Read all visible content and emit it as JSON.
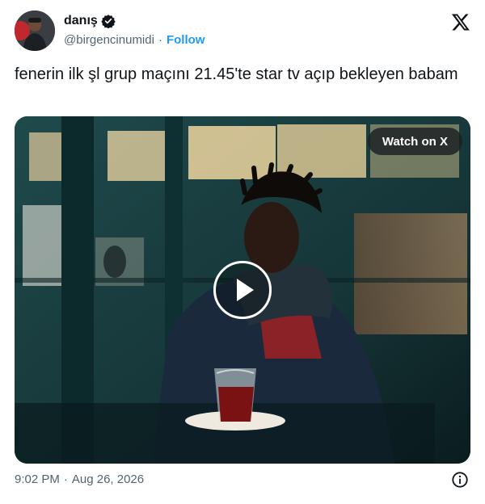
{
  "author": {
    "display_name": "danış",
    "handle": "@birgencinumidi",
    "follow_label": "Follow",
    "separator": "·",
    "verified": true
  },
  "tweet": {
    "text": "fenerin ilk şl grup maçını 21.45'te star tv açıp bekleyen babam"
  },
  "media": {
    "watch_label": "Watch on X",
    "type": "video"
  },
  "footer": {
    "time": "9:02 PM",
    "separator": "·",
    "date": "Aug 26, 2026"
  },
  "icons": {
    "brand": "x-logo-icon",
    "verified": "verified-badge-icon",
    "play": "play-icon",
    "info": "info-icon"
  },
  "colors": {
    "link": "#1d9bf0",
    "secondary_text": "#536471",
    "primary_text": "#0f1419"
  }
}
